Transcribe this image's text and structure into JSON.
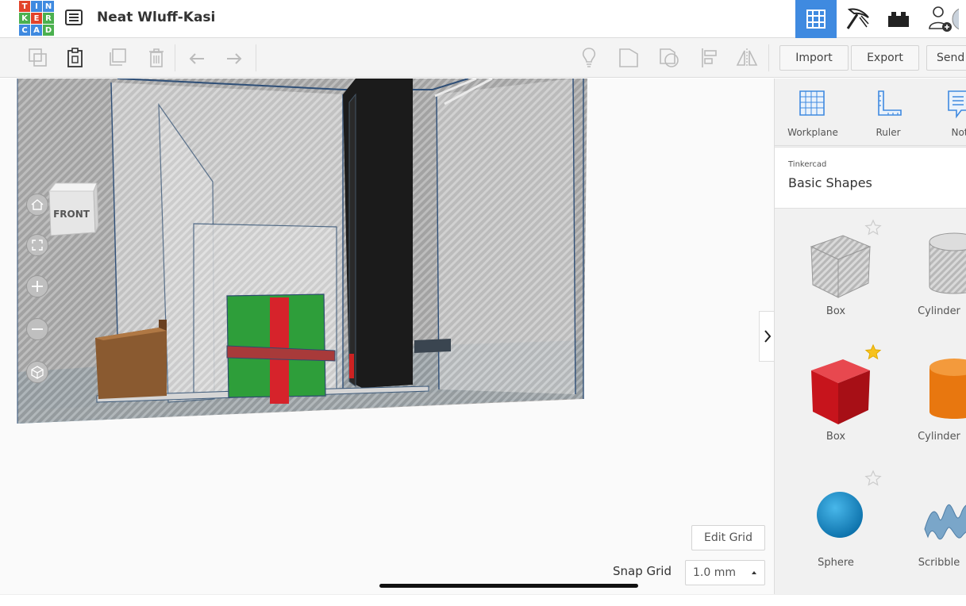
{
  "header": {
    "logo_letters": [
      "T",
      "I",
      "N",
      "K",
      "E",
      "R",
      "C",
      "A",
      "D"
    ],
    "doc_title": "Neat Wluff-Kasi"
  },
  "colors": {
    "accent": "#3f8ae0",
    "logo": [
      "#e2432a",
      "#3f8ae0",
      "#3f8ae0",
      "#4bb04f",
      "#e2432a",
      "#4bb04f",
      "#3f8ae0",
      "#3f8ae0",
      "#4bb04f"
    ]
  },
  "toolbar": {
    "import_label": "Import",
    "export_label": "Export",
    "send_label": "Send"
  },
  "viewport": {
    "view_cube_label": "FRONT",
    "edit_grid_label": "Edit Grid",
    "snap_grid_label": "Snap Grid",
    "snap_grid_value": "1.0 mm"
  },
  "panel": {
    "tools": [
      {
        "label": "Workplane",
        "icon": "workplane-icon"
      },
      {
        "label": "Ruler",
        "icon": "ruler-icon"
      },
      {
        "label": "Not",
        "icon": "notes-icon"
      }
    ],
    "library_source": "Tinkercad",
    "library_name": "Basic Shapes",
    "shapes": [
      {
        "label": "Box",
        "favorite": false
      },
      {
        "label": "Cylinder",
        "favorite": false
      },
      {
        "label": "Box",
        "favorite": true
      },
      {
        "label": "Cylinder",
        "favorite": false
      },
      {
        "label": "Sphere",
        "favorite": false
      },
      {
        "label": "Scribble",
        "favorite": false
      }
    ]
  }
}
